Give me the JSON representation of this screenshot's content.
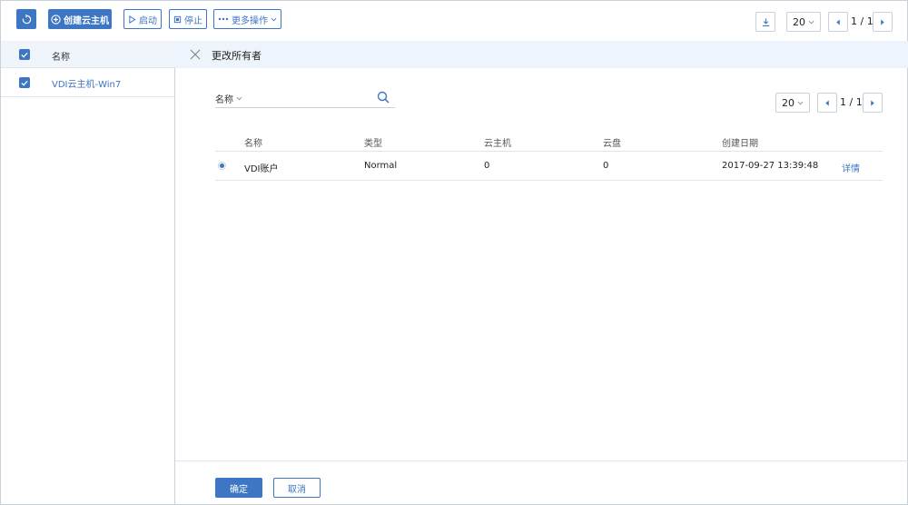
{
  "toolbar": {
    "create_label": "创建云主机",
    "start_label": "启动",
    "stop_label": "停止",
    "more_label": "更多操作",
    "page_size": "20",
    "page_info": "1 / 1"
  },
  "left_list": {
    "header_label": "名称",
    "rows": [
      {
        "name": "VDI云主机-Win7",
        "checked": true
      }
    ]
  },
  "panel": {
    "title": "更改所有者",
    "search": {
      "field_label": "名称",
      "placeholder": ""
    },
    "pagination": {
      "page_size": "20",
      "page_info": "1 / 1"
    },
    "table": {
      "columns": [
        "名称",
        "类型",
        "云主机",
        "云盘",
        "创建日期"
      ],
      "rows": [
        {
          "selected": true,
          "name": "VDI账户",
          "type": "Normal",
          "vm_count": "0",
          "disk_count": "0",
          "created": "2017-09-27 13:39:48",
          "action": "详情"
        }
      ]
    },
    "footer": {
      "ok_label": "确定",
      "cancel_label": "取消"
    }
  },
  "colors": {
    "accent": "#3c76c4",
    "header_bg": "#eef4fb",
    "border": "#c9d1dc"
  }
}
